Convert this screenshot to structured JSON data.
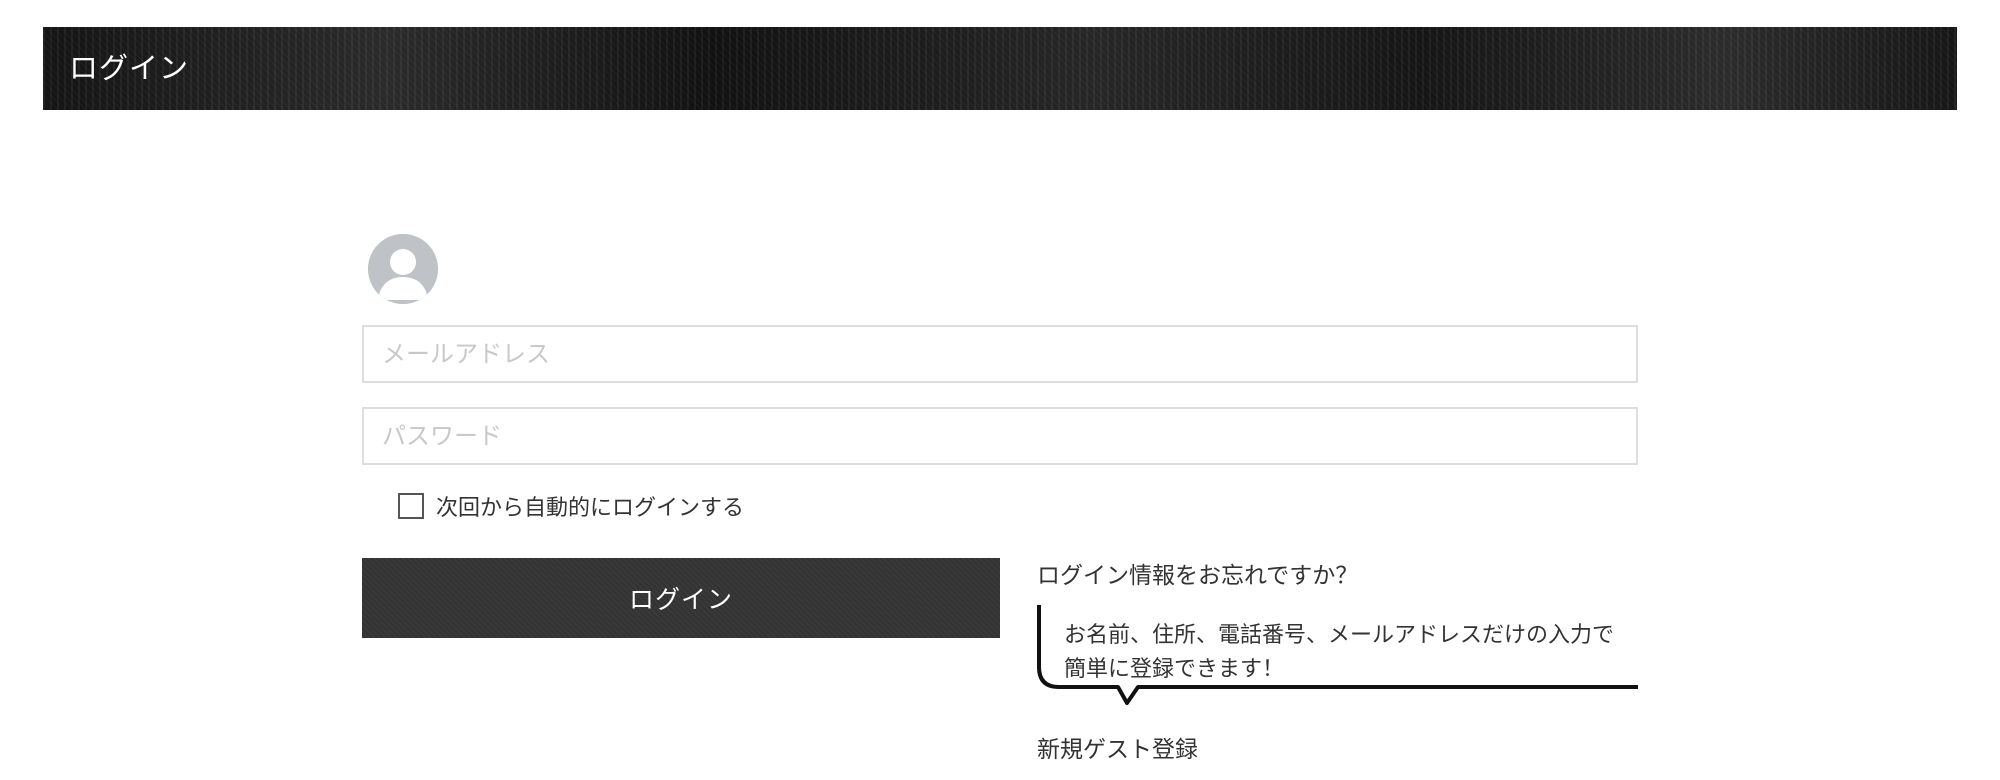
{
  "header": {
    "title": "ログイン"
  },
  "login_form": {
    "avatar_icon": "user-avatar-icon",
    "email_placeholder": "メールアドレス",
    "email_value": "",
    "password_placeholder": "パスワード",
    "password_value": "",
    "remember_label": "次回から自動的にログインする",
    "remember_checked": false,
    "submit_label": "ログイン"
  },
  "side_links": {
    "forgot_label": "ログイン情報をお忘れですか？",
    "bubble_text": "お名前、住所、電話番号、メールアドレスだけの入力で簡単に登録できます！",
    "guest_register_label": "新規ゲスト登録"
  },
  "colors": {
    "header_bg": "#1e1e1e",
    "button_bg": "#333333",
    "avatar_bg": "#bfc3c8",
    "text": "#333333"
  }
}
